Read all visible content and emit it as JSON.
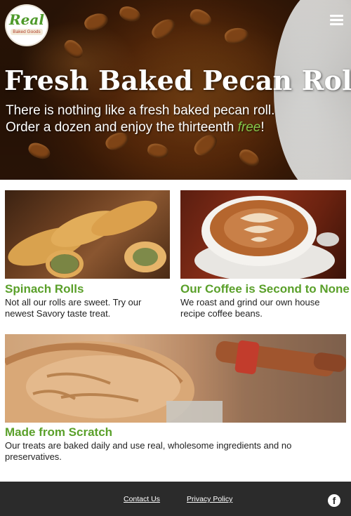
{
  "brand": {
    "logo_main": "Real",
    "logo_sub": "Baked Goods"
  },
  "header": {
    "menu_icon": "hamburger-menu-icon"
  },
  "hero": {
    "title": "Fresh Baked Pecan Rolls",
    "subtitle_line1": "There is nothing like a fresh baked pecan roll.",
    "subtitle_line2_prefix": "Order a dozen and enjoy the thirteenth ",
    "subtitle_free": "free",
    "subtitle_suffix": "!"
  },
  "cards": [
    {
      "title": "Spinach Rolls",
      "text": "Not all our rolls are sweet. Try our newest Savory taste treat."
    },
    {
      "title": "Our Coffee is Second to None",
      "text": "We roast and grind our own house recipe coffee beans."
    },
    {
      "title": "Made from Scratch",
      "text": "Our treats are baked daily and use real, wholesome ingredients and no preservatives."
    }
  ],
  "footer": {
    "links": [
      "Contact Us",
      "Privacy Policy"
    ],
    "social_icon": "facebook-icon"
  },
  "colors": {
    "accent_green": "#5aa02a",
    "footer_bg": "#2b2b2b"
  }
}
